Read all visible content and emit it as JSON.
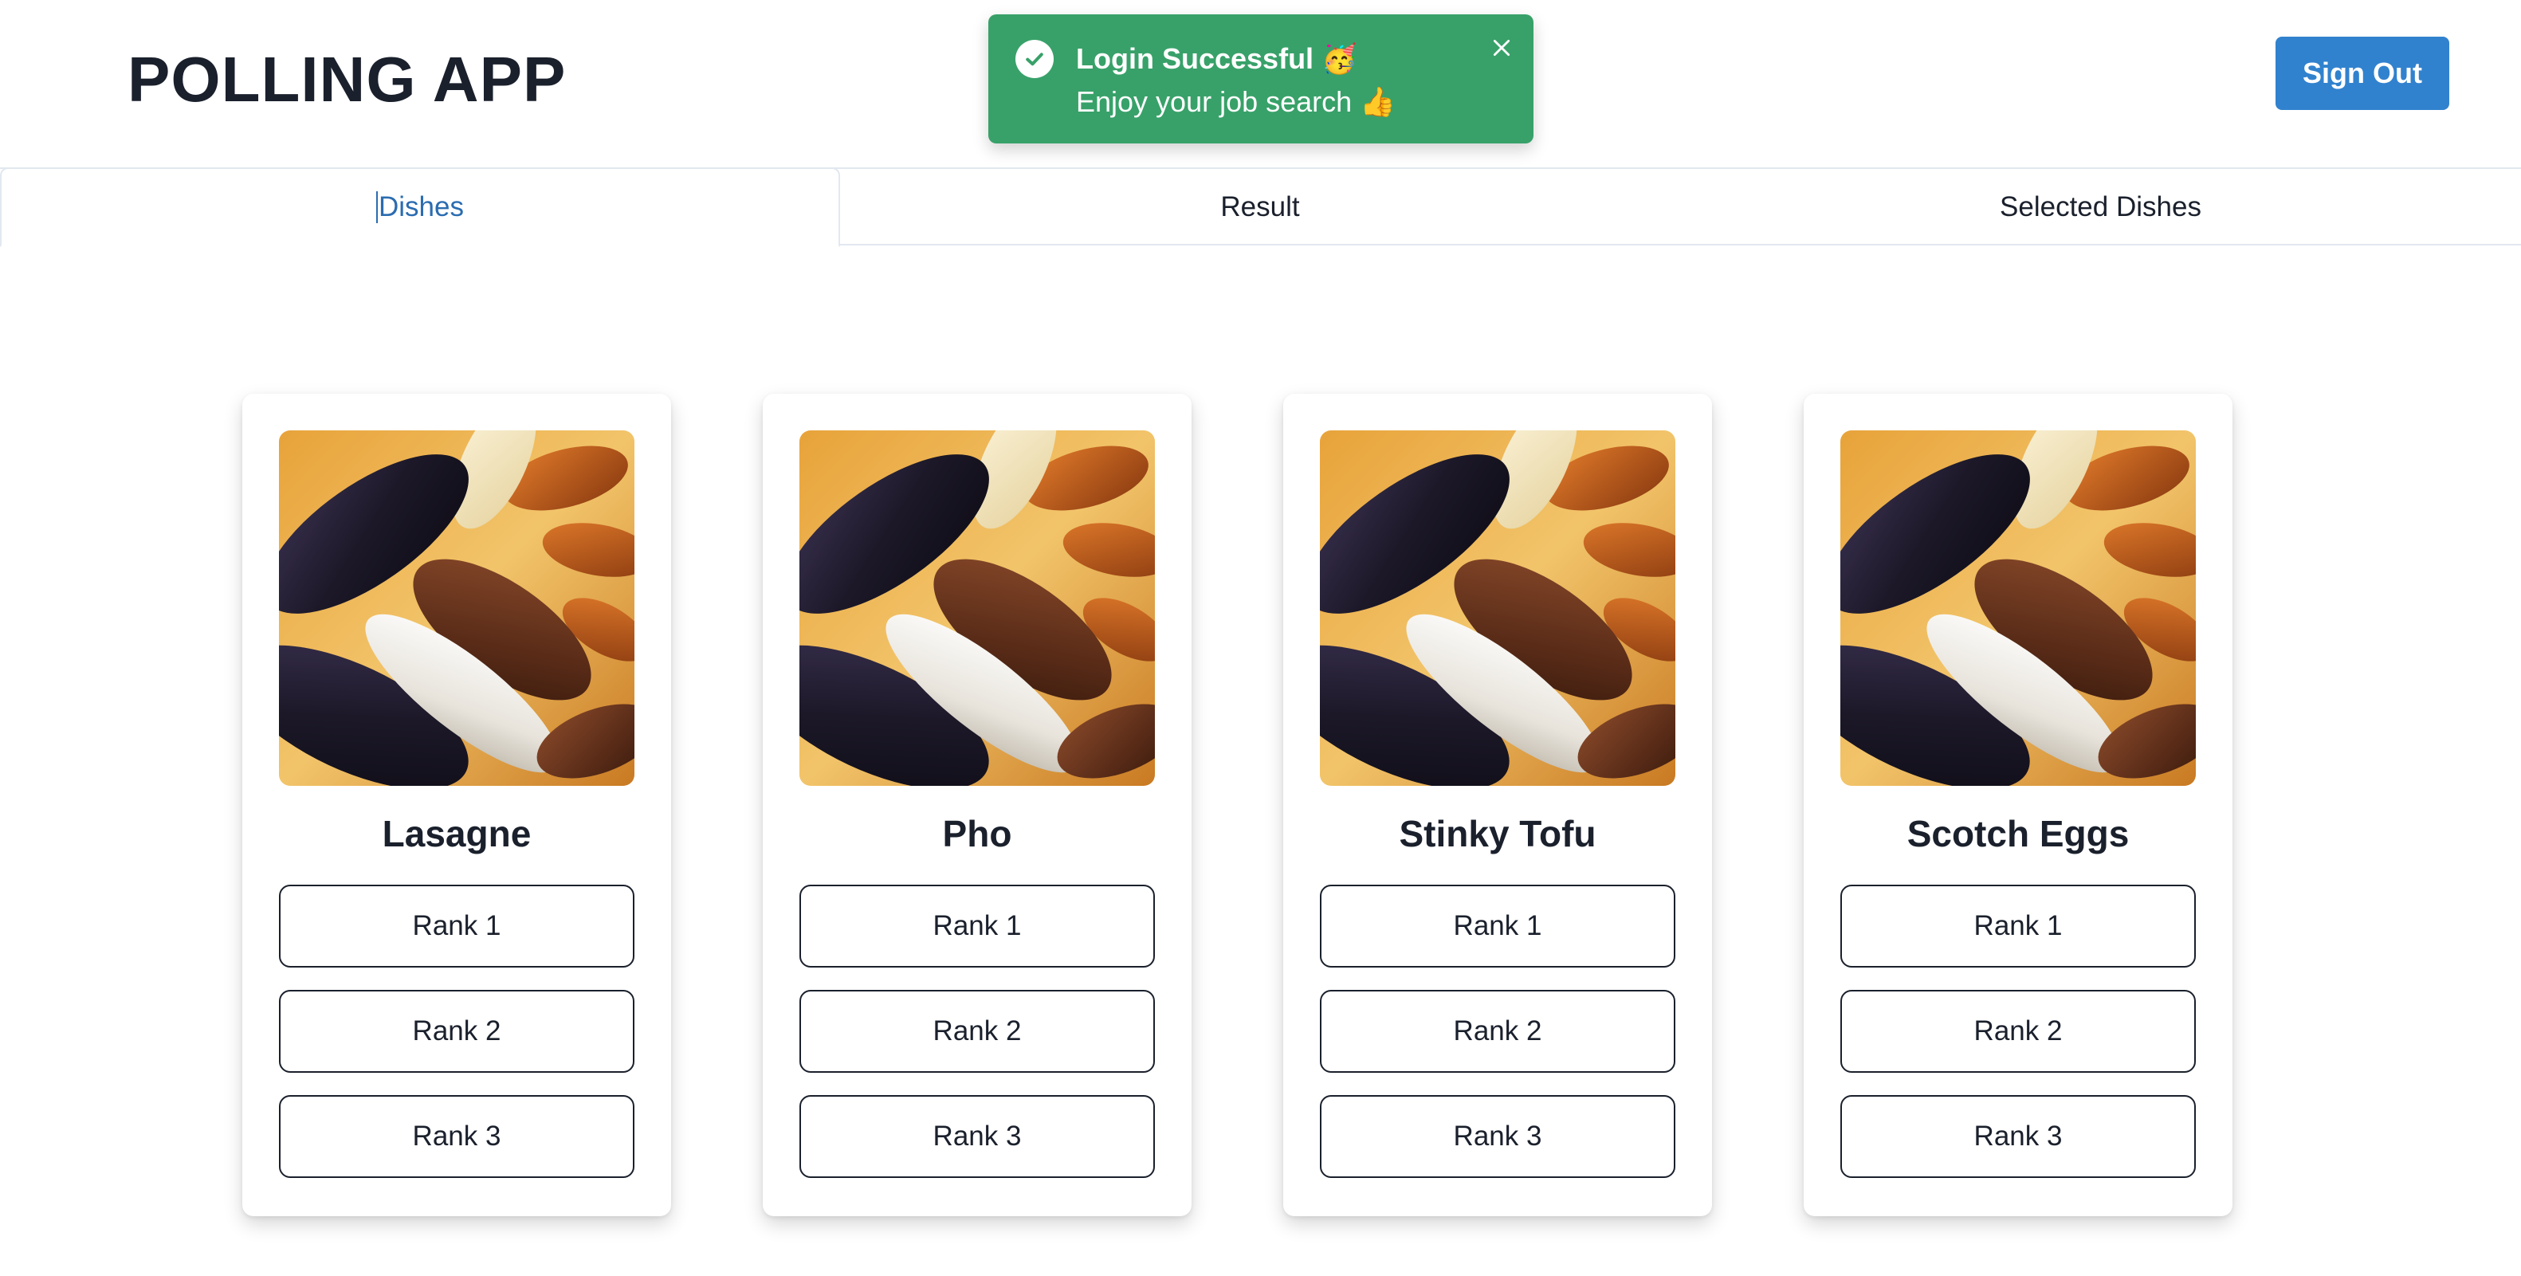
{
  "header": {
    "title": "POLLING APP",
    "signout_label": "Sign Out"
  },
  "toast": {
    "title": "Login Successful 🥳",
    "description": "Enjoy your job search 👍",
    "color": "#38a169"
  },
  "tabs": [
    {
      "label": "Dishes",
      "active": true
    },
    {
      "label": "Result",
      "active": false
    },
    {
      "label": "Selected Dishes",
      "active": false
    }
  ],
  "dishes": [
    {
      "name": "Lasagne",
      "ranks": [
        "Rank 1",
        "Rank 2",
        "Rank 3"
      ]
    },
    {
      "name": "Pho",
      "ranks": [
        "Rank 1",
        "Rank 2",
        "Rank 3"
      ]
    },
    {
      "name": "Stinky Tofu",
      "ranks": [
        "Rank 1",
        "Rank 2",
        "Rank 3"
      ]
    },
    {
      "name": "Scotch Eggs",
      "ranks": [
        "Rank 1",
        "Rank 2",
        "Rank 3"
      ]
    }
  ],
  "colors": {
    "accent": "#3182ce",
    "active_tab_text": "#2b6cb0",
    "toast_success": "#38a169"
  }
}
